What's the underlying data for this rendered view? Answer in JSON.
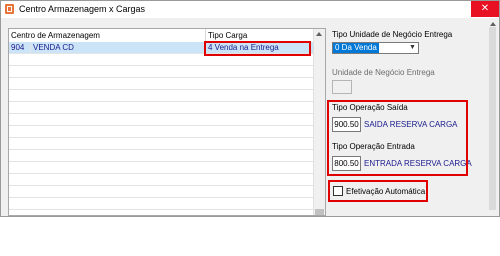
{
  "window": {
    "title": "Centro Armazenagem x Cargas",
    "close_glyph": "✕"
  },
  "grid": {
    "columns": [
      "Centro de Armazenagem",
      "Tipo Carga"
    ],
    "rows": [
      {
        "code": "904",
        "name": "VENDA CD",
        "tipo": "4 Venda na Entrega"
      }
    ]
  },
  "panel": {
    "tipo_unidade_label": "Tipo Unidade de Negócio Entrega",
    "tipo_unidade_value": "0 Da Venda",
    "unidade_label": "Unidade de Negócio Entrega",
    "saida_label": "Tipo Operação Saída",
    "saida_code": "900.50",
    "saida_desc": "SAIDA RESERVA CARGA",
    "entrada_label": "Tipo Operação Entrada",
    "entrada_code": "800.50",
    "entrada_desc": "ENTRADA RESERVA CARGA",
    "efetivacao_label": "Efetivação Automática",
    "efetivacao_checked": false
  },
  "colors": {
    "highlight": "#e00000",
    "selection": "#cce4f7",
    "combo_selected": "#0078d7"
  }
}
